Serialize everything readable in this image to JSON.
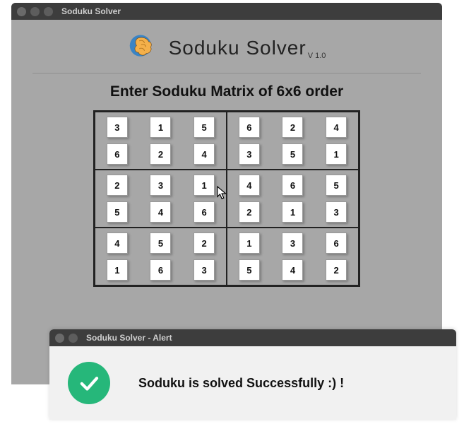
{
  "main_window": {
    "title": "Soduku Solver"
  },
  "header": {
    "app_name": "Soduku Solver",
    "version": "V 1.0"
  },
  "instruction": "Enter Soduku Matrix of 6x6 order",
  "grid": {
    "box0": [
      "3",
      "1",
      "5",
      "6",
      "2",
      "4"
    ],
    "box1": [
      "6",
      "2",
      "4",
      "3",
      "5",
      "1"
    ],
    "box2": [
      "2",
      "3",
      "1",
      "5",
      "4",
      "6"
    ],
    "box3": [
      "4",
      "6",
      "5",
      "2",
      "1",
      "3"
    ],
    "box4": [
      "4",
      "5",
      "2",
      "1",
      "6",
      "3"
    ],
    "box5": [
      "1",
      "3",
      "6",
      "5",
      "4",
      "2"
    ]
  },
  "alert": {
    "title": "Soduku Solver - Alert",
    "message": "Soduku is solved Successfully :) !"
  },
  "colors": {
    "success": "#26b77a",
    "brain_fill": "#3a84c5"
  }
}
